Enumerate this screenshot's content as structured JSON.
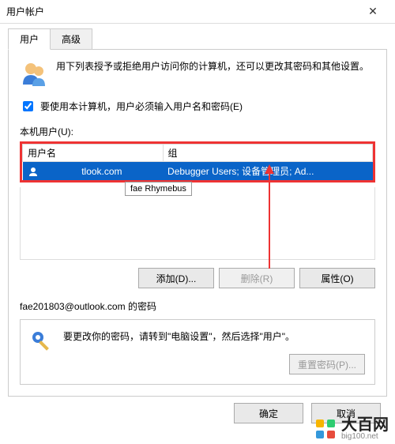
{
  "window": {
    "title": "用户帐户"
  },
  "tabs": {
    "user": "用户",
    "advanced": "高级"
  },
  "info": {
    "text": "用下列表授予或拒绝用户访问你的计算机，还可以更改其密码和其他设置。"
  },
  "checkbox": {
    "label": "要使用本计算机，用户必须输入用户名和密码(E)"
  },
  "labels": {
    "local_users": "本机用户(U):"
  },
  "table": {
    "headers": {
      "username": "用户名",
      "group": "组"
    },
    "rows": [
      {
        "username_hidden": "tlook.com",
        "group": "Debugger Users; 设备管理员; Ad..."
      }
    ],
    "tooltip": "fae Rhymebus"
  },
  "buttons": {
    "add": "添加(D)...",
    "delete": "删除(R)",
    "properties": "属性(O)",
    "reset_pw": "重置密码(P)...",
    "ok": "确定",
    "cancel": "取消"
  },
  "section2": {
    "title": "fae201803@outlook.com 的密码",
    "text": "要更改你的密码，请转到\"电脑设置\"，然后选择\"用户\"。"
  },
  "watermark": {
    "name": "大百网",
    "domain": "big100.net"
  }
}
